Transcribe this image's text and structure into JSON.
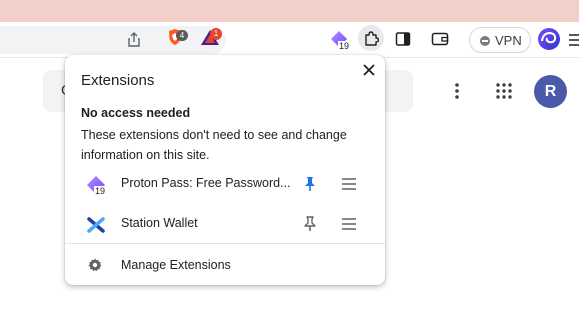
{
  "toolbar": {
    "brave_shield_count": "4",
    "rewards_badge": "1",
    "proton_badge_count": "19",
    "vpn_label": "VPN",
    "accent_color": "#4a5aa8"
  },
  "page": {
    "search_initial": "G",
    "avatar_initial": "R"
  },
  "extensions_popup": {
    "title": "Extensions",
    "section_title": "No access needed",
    "section_description": "These extensions don't need to see and change information on this site.",
    "items": [
      {
        "name": "Proton Pass: Free Password...",
        "badge": "19",
        "icon": "proton-pass-icon",
        "pinned": true
      },
      {
        "name": "Station Wallet",
        "icon": "station-wallet-icon",
        "pinned": false
      }
    ],
    "manage_label": "Manage Extensions"
  }
}
